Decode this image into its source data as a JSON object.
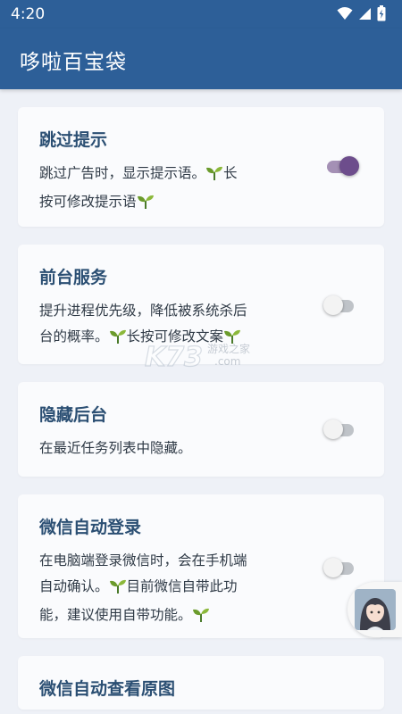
{
  "status_bar": {
    "time": "4:20"
  },
  "app_bar": {
    "title": "哆啦百宝袋"
  },
  "settings": [
    {
      "title": "跳过提示",
      "desc_lines": [
        "跳过广告时，显示提示语。",
        "长",
        "按可修改提示语"
      ],
      "enabled": true
    },
    {
      "title": "前台服务",
      "desc_lines": [
        "提升进程优先级，降低被系统杀后",
        "台的概率。",
        "长按可修改文案"
      ],
      "enabled": false
    },
    {
      "title": "隐藏后台",
      "desc_lines": [
        "在最近任务列表中隐藏。"
      ],
      "enabled": false
    },
    {
      "title": "微信自动登录",
      "desc_lines": [
        "在电脑端登录微信时，会在手机端",
        "自动确认。",
        "目前微信自带此功",
        "能，建议使用自带功能。"
      ],
      "enabled": false
    },
    {
      "title": "微信自动查看原图"
    }
  ],
  "watermark": {
    "brand": "K73",
    "text": "游戏之家",
    "url": ".com"
  },
  "icons": {
    "sprout": "sprout-icon",
    "wifi": "wifi-icon",
    "signal": "signal-icon",
    "battery": "battery-icon"
  }
}
